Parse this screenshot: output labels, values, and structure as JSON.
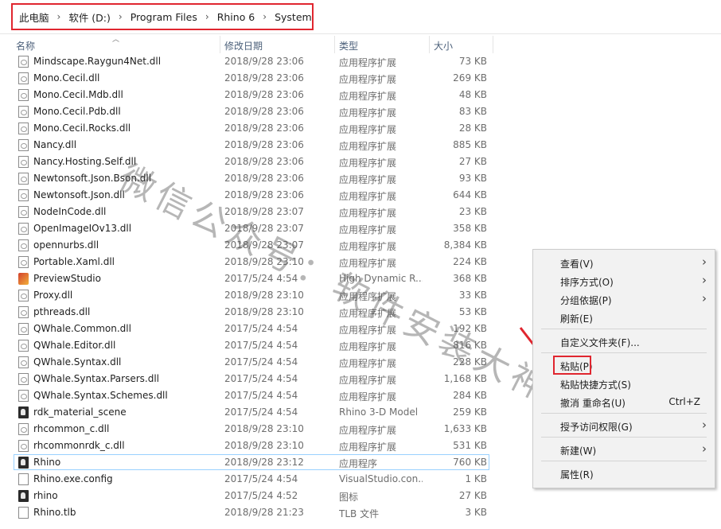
{
  "breadcrumb": [
    "此电脑",
    "软件 (D:)",
    "Program Files",
    "Rhino 6",
    "System"
  ],
  "columns": {
    "name": "名称",
    "date": "修改日期",
    "type": "类型",
    "size": "大小"
  },
  "files": [
    {
      "name": "Mindscape.Raygun4Net.dll",
      "date": "2018/9/28 23:06",
      "type": "应用程序扩展",
      "size": "73 KB",
      "icon": "dll-icon"
    },
    {
      "name": "Mono.Cecil.dll",
      "date": "2018/9/28 23:06",
      "type": "应用程序扩展",
      "size": "269 KB",
      "icon": "dll-icon"
    },
    {
      "name": "Mono.Cecil.Mdb.dll",
      "date": "2018/9/28 23:06",
      "type": "应用程序扩展",
      "size": "48 KB",
      "icon": "dll-icon"
    },
    {
      "name": "Mono.Cecil.Pdb.dll",
      "date": "2018/9/28 23:06",
      "type": "应用程序扩展",
      "size": "83 KB",
      "icon": "dll-icon"
    },
    {
      "name": "Mono.Cecil.Rocks.dll",
      "date": "2018/9/28 23:06",
      "type": "应用程序扩展",
      "size": "28 KB",
      "icon": "dll-icon"
    },
    {
      "name": "Nancy.dll",
      "date": "2018/9/28 23:06",
      "type": "应用程序扩展",
      "size": "885 KB",
      "icon": "dll-icon"
    },
    {
      "name": "Nancy.Hosting.Self.dll",
      "date": "2018/9/28 23:06",
      "type": "应用程序扩展",
      "size": "27 KB",
      "icon": "dll-icon"
    },
    {
      "name": "Newtonsoft.Json.Bson.dll",
      "date": "2018/9/28 23:06",
      "type": "应用程序扩展",
      "size": "93 KB",
      "icon": "dll-icon"
    },
    {
      "name": "Newtonsoft.Json.dll",
      "date": "2018/9/28 23:06",
      "type": "应用程序扩展",
      "size": "644 KB",
      "icon": "dll-icon"
    },
    {
      "name": "NodeInCode.dll",
      "date": "2018/9/28 23:07",
      "type": "应用程序扩展",
      "size": "23 KB",
      "icon": "dll-icon"
    },
    {
      "name": "OpenImageIOv13.dll",
      "date": "2018/9/28 23:07",
      "type": "应用程序扩展",
      "size": "358 KB",
      "icon": "dll-icon"
    },
    {
      "name": "opennurbs.dll",
      "date": "2018/9/28 23:07",
      "type": "应用程序扩展",
      "size": "8,384 KB",
      "icon": "dll-icon"
    },
    {
      "name": "Portable.Xaml.dll",
      "date": "2018/9/28 23:10",
      "type": "应用程序扩展",
      "size": "224 KB",
      "icon": "dll-icon"
    },
    {
      "name": "PreviewStudio",
      "date": "2017/5/24 4:54",
      "type": "High Dynamic R...",
      "size": "368 KB",
      "icon": "hdr-image-icon"
    },
    {
      "name": "Proxy.dll",
      "date": "2018/9/28 23:10",
      "type": "应用程序扩展",
      "size": "33 KB",
      "icon": "dll-icon"
    },
    {
      "name": "pthreads.dll",
      "date": "2018/9/28 23:10",
      "type": "应用程序扩展",
      "size": "53 KB",
      "icon": "dll-icon"
    },
    {
      "name": "QWhale.Common.dll",
      "date": "2017/5/24 4:54",
      "type": "应用程序扩展",
      "size": "192 KB",
      "icon": "dll-icon"
    },
    {
      "name": "QWhale.Editor.dll",
      "date": "2017/5/24 4:54",
      "type": "应用程序扩展",
      "size": "816 KB",
      "icon": "dll-icon"
    },
    {
      "name": "QWhale.Syntax.dll",
      "date": "2017/5/24 4:54",
      "type": "应用程序扩展",
      "size": "228 KB",
      "icon": "dll-icon"
    },
    {
      "name": "QWhale.Syntax.Parsers.dll",
      "date": "2017/5/24 4:54",
      "type": "应用程序扩展",
      "size": "1,168 KB",
      "icon": "dll-icon"
    },
    {
      "name": "QWhale.Syntax.Schemes.dll",
      "date": "2017/5/24 4:54",
      "type": "应用程序扩展",
      "size": "284 KB",
      "icon": "dll-icon"
    },
    {
      "name": "rdk_material_scene",
      "date": "2017/5/24 4:54",
      "type": "Rhino 3-D Model",
      "size": "259 KB",
      "icon": "rhino-model-icon"
    },
    {
      "name": "rhcommon_c.dll",
      "date": "2018/9/28 23:10",
      "type": "应用程序扩展",
      "size": "1,633 KB",
      "icon": "dll-icon"
    },
    {
      "name": "rhcommonrdk_c.dll",
      "date": "2018/9/28 23:10",
      "type": "应用程序扩展",
      "size": "531 KB",
      "icon": "dll-icon"
    },
    {
      "name": "Rhino",
      "date": "2018/9/28 23:12",
      "type": "应用程序",
      "size": "760 KB",
      "icon": "rhino-app-icon",
      "selected": true
    },
    {
      "name": "Rhino.exe.config",
      "date": "2017/5/24 4:54",
      "type": "VisualStudio.con...",
      "size": "1 KB",
      "icon": "config-file-icon"
    },
    {
      "name": "rhino",
      "date": "2017/5/24 4:52",
      "type": "图标",
      "size": "27 KB",
      "icon": "rhino-icon-file-icon"
    },
    {
      "name": "Rhino.tlb",
      "date": "2018/9/28 21:23",
      "type": "TLB 文件",
      "size": "3 KB",
      "icon": "tlb-file-icon"
    }
  ],
  "context_menu": {
    "items": [
      {
        "label": "查看(V)",
        "submenu": true
      },
      {
        "label": "排序方式(O)",
        "submenu": true
      },
      {
        "label": "分组依据(P)",
        "submenu": true
      },
      {
        "label": "刷新(E)",
        "submenu": false
      },
      {
        "label": "自定义文件夹(F)...",
        "submenu": false
      },
      {
        "label": "粘贴(P)",
        "submenu": false
      },
      {
        "label": "粘贴快捷方式(S)",
        "submenu": false
      },
      {
        "label": "撤消 重命名(U)",
        "shortcut": "Ctrl+Z",
        "submenu": false
      },
      {
        "label": "授予访问权限(G)",
        "submenu": true
      },
      {
        "label": "新建(W)",
        "submenu": true
      },
      {
        "label": "属性(R)",
        "submenu": false
      }
    ]
  },
  "watermark": "微信公众号：软件安装大神",
  "colors": {
    "highlight_red": "#e0262f",
    "selection_border": "#99d1ff",
    "header_text": "#4c607a"
  }
}
